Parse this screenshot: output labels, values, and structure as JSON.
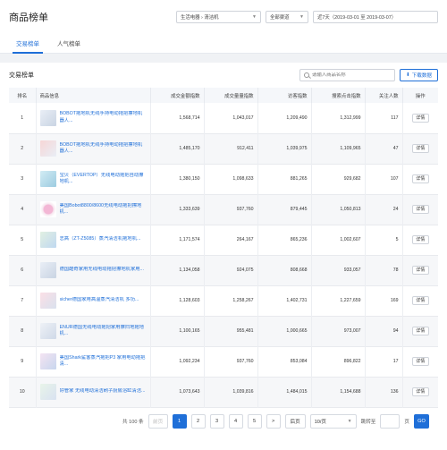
{
  "header": {
    "title": "商品榜单",
    "category_select": "生活电器 › 清洁机",
    "channel_select": "全部渠道",
    "date_select": "近7天（2019-03-01 至 2019-03-07）"
  },
  "tabs": [
    {
      "label": "交易榜单",
      "active": true
    },
    {
      "label": "人气榜单",
      "active": false
    }
  ],
  "panel": {
    "title": "交易榜单",
    "search_placeholder": "请输入商品名称",
    "download_label": "下载数据"
  },
  "table": {
    "columns": [
      "排名",
      "商品信息",
      "成交金额指数",
      "成交量量指数",
      "访客指数",
      "搜索点击指数",
      "关注人数",
      "操作"
    ],
    "rows": [
      {
        "rank": "1",
        "name": "BOBOT拖地机无线手持电动拖把擦地机器人...",
        "amount": "1,568,714",
        "volume": "1,043,017",
        "visitors": "1,209,490",
        "search": "1,312,999",
        "followers": "117",
        "action": "详情"
      },
      {
        "rank": "2",
        "name": "BOBOT拖地机无线手持电动拖把擦地机器人...",
        "amount": "1,485,170",
        "volume": "912,411",
        "visitors": "1,039,975",
        "search": "1,109,965",
        "followers": "47",
        "action": "详情"
      },
      {
        "rank": "3",
        "name": "宝贝（EVERTOP）无线电动拖把自动擦地机...",
        "amount": "1,380,150",
        "volume": "1,098,633",
        "visitors": "881,265",
        "search": "929,682",
        "followers": "107",
        "action": "详情"
      },
      {
        "rank": "4",
        "name": "美国Bobot8800/8600无线电动拖把擦地机...",
        "amount": "1,333,639",
        "volume": "937,760",
        "visitors": "879,445",
        "search": "1,050,813",
        "followers": "24",
        "action": "详情"
      },
      {
        "rank": "5",
        "name": "志高（ZT-Z5085）蒸汽清洁机拖地机...",
        "amount": "1,171,574",
        "volume": "264,167",
        "visitors": "865,236",
        "search": "1,002,607",
        "followers": "5",
        "action": "详情"
      },
      {
        "rank": "6",
        "name": "德国酷奇家用无线电动拖把擦地机家用...",
        "amount": "1,134,058",
        "volume": "924,075",
        "visitors": "808,668",
        "search": "933,057",
        "followers": "78",
        "action": "详情"
      },
      {
        "rank": "7",
        "name": "sicher德国家用高温蒸汽清洁机 多功...",
        "amount": "1,128,603",
        "volume": "1,258,267",
        "visitors": "1,402,731",
        "search": "1,227,659",
        "followers": "169",
        "action": "详情"
      },
      {
        "rank": "8",
        "name": "ENUR德国无线电动拖把家用擦扫地拖地机...",
        "amount": "1,100,165",
        "volume": "955,481",
        "visitors": "1,000,665",
        "search": "973,007",
        "followers": "94",
        "action": "详情"
      },
      {
        "rank": "9",
        "name": "美国Shark鲨客蒸汽拖把P3 家用电动拖把清...",
        "amount": "1,092,234",
        "volume": "937,760",
        "visitors": "853,084",
        "search": "896,822",
        "followers": "17",
        "action": "详情"
      },
      {
        "rank": "10",
        "name": "好管家 无线电动清洁刷子厨房浴缸清洁...",
        "amount": "1,073,643",
        "volume": "1,039,816",
        "visitors": "1,484,015",
        "search": "1,154,688",
        "followers": "136",
        "action": "详情"
      }
    ]
  },
  "pagination": {
    "total": "共 100 条",
    "prev": "前页",
    "pages": [
      "1",
      "2",
      "3",
      "4",
      "5"
    ],
    "current": "1",
    "next_arrow": ">",
    "next": "后页",
    "page_size": "10/页",
    "jump_label": "跳转至",
    "page_unit": "页",
    "go": "GO"
  }
}
